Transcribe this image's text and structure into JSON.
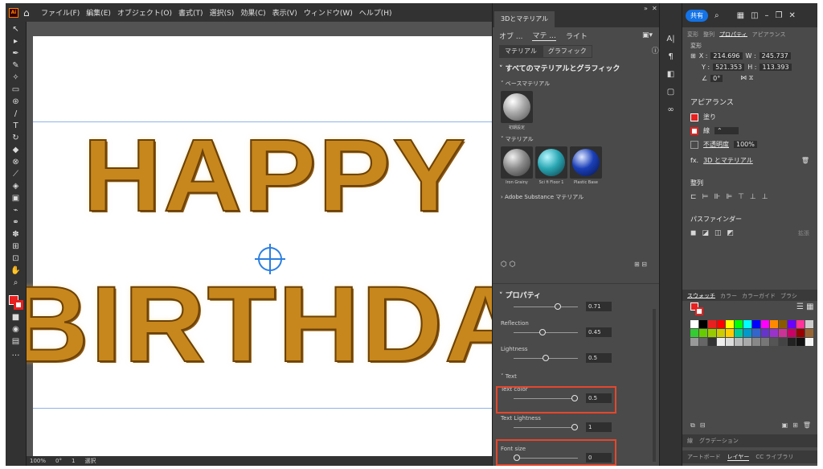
{
  "menu": {
    "logo": "Ai",
    "items": [
      "ファイル(F)",
      "編集(E)",
      "オブジェクト(O)",
      "書式(T)",
      "選択(S)",
      "効果(C)",
      "表示(V)",
      "ウィンドウ(W)",
      "ヘルプ(H)"
    ]
  },
  "canvas": {
    "line1": "HAPPY",
    "line2": "BIRTHDAY",
    "text_color": "#c8871c"
  },
  "status": {
    "zoom": "100%",
    "rotation": "0°",
    "page": "1",
    "mode": "選択"
  },
  "panel3d": {
    "tab": "3Dとマテリアル",
    "subtabs": [
      "オブ ...",
      "マテ ...",
      "ライト"
    ],
    "buttons": [
      "マテリアル",
      "グラフィック"
    ],
    "all_title": "すべてのマテリアルとグラフィック",
    "base_label": "ベースマテリアル",
    "base_item": "初期設定",
    "materials_label": "マテリアル",
    "materials": [
      {
        "name": "Iron Grainy",
        "color": "#7a7a7a"
      },
      {
        "name": "Sci fi Floor 1",
        "color": "#2aa7b3"
      },
      {
        "name": "Plastic Base",
        "color": "#1a3fb8"
      }
    ],
    "substance": "Adobe Substance マテリアル",
    "properties_title": "プロパティ",
    "props": [
      {
        "label": "",
        "value": "0.71",
        "pos": 0.71
      },
      {
        "label": "Reflection",
        "value": "0.45",
        "pos": 0.45
      },
      {
        "label": "Lightness",
        "value": "0.5",
        "pos": 0.5
      }
    ],
    "text_group": "Text",
    "text_props": [
      {
        "label": "Text color",
        "value": "0.5",
        "pos": 1.0
      },
      {
        "label": "Text Lightness",
        "value": "1",
        "pos": 1.0
      },
      {
        "label": "Font size",
        "value": "0",
        "pos": 0.0
      }
    ],
    "highlight_color": "#e4472d"
  },
  "props": {
    "share": "共有",
    "tabs": [
      "変形",
      "整列",
      "プロパティ",
      "アピアランス"
    ],
    "transform_label": "変形",
    "x": "214.696",
    "y": "521.353",
    "w": "245.737",
    "h": "113.393",
    "angle": "0°",
    "x_label": "X :",
    "y_label": "Y :",
    "w_label": "W :",
    "h_label": "H :",
    "appearance": "アピアランス",
    "fill_label": "塗り",
    "stroke_label": "線",
    "opacity_label": "不透明度",
    "opacity_value": "100%",
    "fx_label": "3D とマテリアル",
    "align": "整列",
    "pathfinder": "パスファインダー",
    "expand": "拡張",
    "swatch_tabs": [
      "スウォッチ",
      "カラー",
      "カラーガイド",
      "ブラシ"
    ],
    "bottom_tabs1": [
      "線",
      "グラデーション"
    ],
    "bottom_tabs2": [
      "アートボード",
      "レイヤー",
      "CC ライブラリ"
    ]
  },
  "swatch_colors": [
    "#ffffff",
    "#000000",
    "#e8201f",
    "#ff0000",
    "#ffff00",
    "#00ff00",
    "#00ffff",
    "#0000ff",
    "#ff00ff",
    "#ff8a00",
    "#8a5a00",
    "#6a00ff",
    "#ff3399",
    "#cccccc",
    "#33cc33",
    "#66cc00",
    "#99cc00",
    "#cccc00",
    "#ffcc00",
    "#00cc99",
    "#0099cc",
    "#3366cc",
    "#6633cc",
    "#9933cc",
    "#cc3399",
    "#cc0066",
    "#990000",
    "#996633",
    "#999999",
    "#666666",
    "#333333",
    "#eeeeee",
    "#dddddd",
    "#bbbbbb",
    "#aaaaaa",
    "#888888",
    "#777777",
    "#555555",
    "#444444",
    "#222222",
    "#111111",
    "#f5f5f5"
  ]
}
